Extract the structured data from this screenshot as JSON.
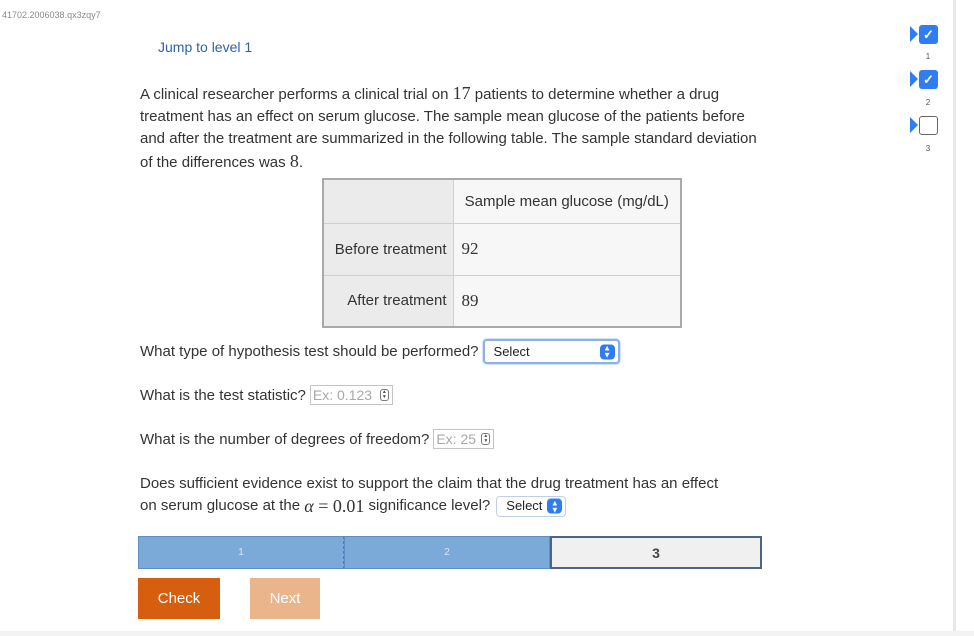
{
  "activity_id": "41702.2006038.qx3zqy7",
  "jump_link": "Jump to level 1",
  "prompt": {
    "text1": "A clinical researcher performs a clinical trial on ",
    "patients": "17",
    "text2": " patients to determine whether a drug treatment has an effect on serum glucose. The sample mean glucose of the patients before and after the treatment are summarized in the following table. The sample standard deviation of the differences was ",
    "sd": "8",
    "text3": "."
  },
  "table": {
    "column_header": "Sample mean glucose (mg/dL)",
    "rows": [
      {
        "label": "Before treatment",
        "value": "92"
      },
      {
        "label": "After treatment",
        "value": "89"
      }
    ]
  },
  "questions": {
    "test_type": {
      "label": "What type of hypothesis test should be performed?",
      "select": "Select"
    },
    "test_statistic": {
      "label": "What is the test statistic?",
      "placeholder": "Ex: 0.123"
    },
    "df": {
      "label": "What is the number of degrees of freedom?",
      "placeholder": "Ex: 25"
    },
    "evidence": {
      "line1": "Does sufficient evidence exist to support the claim that the drug treatment has an effect",
      "line2a": "on serum glucose at the ",
      "alpha_symbol": "α",
      "equals": " = ",
      "alpha_value": "0.01",
      "line2b": " significance level?",
      "select": "Select"
    }
  },
  "progress": {
    "segments": [
      {
        "label": "1",
        "status": "done"
      },
      {
        "label": "2",
        "status": "done"
      },
      {
        "label": "3",
        "status": "current"
      }
    ]
  },
  "buttons": {
    "check": "Check",
    "next": "Next"
  },
  "levels": [
    {
      "number": "1",
      "checked": true
    },
    {
      "number": "2",
      "checked": true
    },
    {
      "number": "3",
      "checked": false
    }
  ],
  "colors": {
    "accent": "#2f7df0",
    "check_button": "#d55f0f",
    "next_button": "#ebb58c",
    "progress_done": "#7baad8",
    "progress_current_border": "#4d6585",
    "link": "#2e62a8"
  },
  "icons": {
    "checkmark": "check-icon",
    "select_caret": "select-caret-icon",
    "spinner": "spinner-icon",
    "level_arrow": "arrow-right-icon"
  }
}
